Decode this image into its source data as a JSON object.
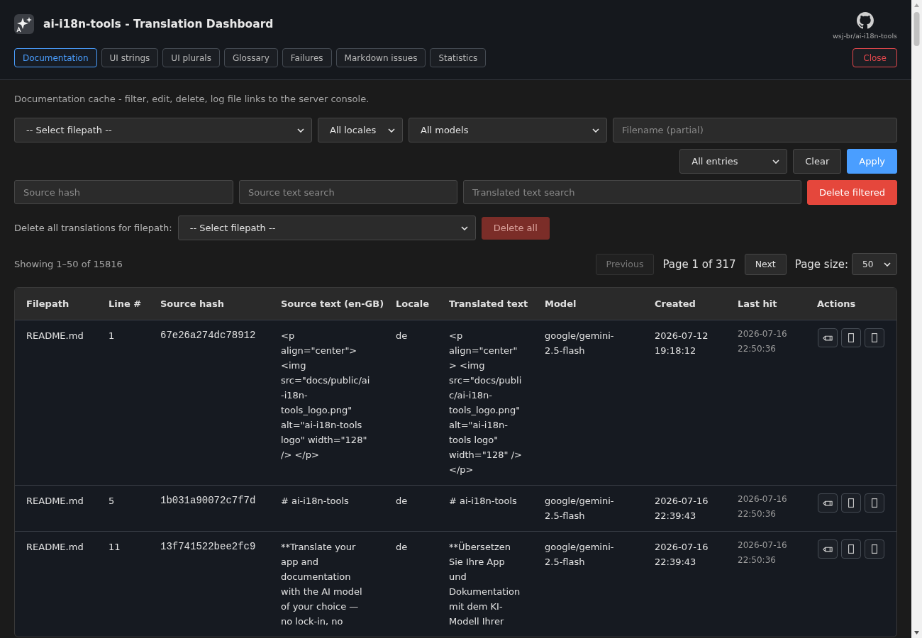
{
  "header": {
    "title": "ai-i18n-tools - Translation Dashboard",
    "repo_link": "wsj-br/ai-i18n-tools"
  },
  "tabs": [
    {
      "label": "Documentation",
      "selected": true
    },
    {
      "label": "UI strings",
      "selected": false
    },
    {
      "label": "UI plurals",
      "selected": false
    },
    {
      "label": "Glossary",
      "selected": false
    },
    {
      "label": "Failures",
      "selected": false
    },
    {
      "label": "Markdown issues",
      "selected": false
    },
    {
      "label": "Statistics",
      "selected": false
    }
  ],
  "close_button": "Close",
  "description": "Documentation cache - filter, edit, delete, log file links to the server console.",
  "filters": {
    "filepath_select": "-- Select filepath --",
    "locale_select": "All locales",
    "model_select": "All models",
    "filename_field": {
      "placeholder": "Filename (partial)"
    },
    "entries_select": "All entries",
    "clear_button": "Clear",
    "apply_button": "Apply",
    "source_hash_field": {
      "placeholder": "Source hash"
    },
    "source_text_field": {
      "placeholder": "Source text search"
    },
    "translated_text_field": {
      "placeholder": "Translated text search"
    },
    "delete_filtered_button": "Delete filtered"
  },
  "delete_all": {
    "label": "Delete all translations for filepath:",
    "filepath_select": "-- Select filepath --",
    "button": {
      "label": "Delete all",
      "disabled": true
    }
  },
  "pagination": {
    "summary": "Showing 1–50 of 15816",
    "previous": {
      "label": "Previous",
      "disabled": true
    },
    "page": "Page 1 of 317",
    "next": {
      "label": "Next",
      "disabled": false
    },
    "page_size_label": "Page size:",
    "page_size": "50"
  },
  "table": {
    "columns": [
      "Filepath",
      "Line #",
      "Source hash",
      "Source text (en-GB)",
      "Locale",
      "Translated text",
      "Model",
      "Created",
      "Last hit",
      "Actions"
    ],
    "rows": [
      {
        "filepath": "README.md",
        "line": "1",
        "source_hash": "67e26a274dc78912",
        "source_text": "<p align=\"center\"> <img src=\"docs/public/ai-i18n-tools_logo.png\" alt=\"ai-i18n-tools logo\" width=\"128\" /> </p>",
        "locale": "de",
        "translated_text": "<p align=\"center\"> <img src=\"docs/public/ai-i18n-tools_logo.png\" alt=\"ai-i18n-tools logo\" width=\"128\" /> </p>",
        "model": "google/gemini-2.5-flash",
        "created": "2026-07-12 19:18:12",
        "last_hit": "2026-07-16 22:50:36"
      },
      {
        "filepath": "README.md",
        "line": "5",
        "source_hash": "1b031a90072c7f7d",
        "source_text": "# ai-i18n-tools",
        "locale": "de",
        "translated_text": "# ai-i18n-tools",
        "model": "google/gemini-2.5-flash",
        "created": "2026-07-16 22:39:43",
        "last_hit": "2026-07-16 22:50:36"
      },
      {
        "filepath": "README.md",
        "line": "11",
        "source_hash": "13f741522bee2fc9",
        "source_text": "**Translate your app and documentation with the AI model of your choice — no lock-in, no",
        "locale": "de",
        "translated_text": "**Übersetzen Sie Ihre App und Dokumentation mit dem KI-Modell Ihrer",
        "model": "google/gemini-2.5-flash",
        "created": "2026-07-16 22:39:43",
        "last_hit": "2026-07-16 22:50:36"
      }
    ]
  }
}
